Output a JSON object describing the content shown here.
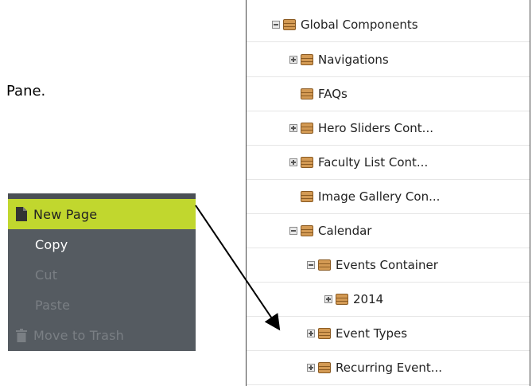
{
  "caption_fragment": "Pane.",
  "context_menu": {
    "items": [
      {
        "label": "New Page",
        "icon": "page-icon",
        "state": "active"
      },
      {
        "label": "Copy",
        "icon": "",
        "state": "enabled"
      },
      {
        "label": "Cut",
        "icon": "",
        "state": "disabled"
      },
      {
        "label": "Paste",
        "icon": "",
        "state": "disabled"
      },
      {
        "label": "Move to Trash",
        "icon": "trash-icon",
        "state": "disabled"
      }
    ]
  },
  "tree": {
    "rows": [
      {
        "label": "Global Components",
        "toggle": "minus"
      },
      {
        "label": "Navigations",
        "toggle": "plus"
      },
      {
        "label": "FAQs",
        "toggle": "none"
      },
      {
        "label": "Hero Sliders Cont...",
        "toggle": "plus"
      },
      {
        "label": "Faculty List Cont...",
        "toggle": "plus"
      },
      {
        "label": "Image Gallery Con...",
        "toggle": "none"
      },
      {
        "label": "Calendar",
        "toggle": "minus"
      },
      {
        "label": "Events Container",
        "toggle": "minus"
      },
      {
        "label": "2014",
        "toggle": "plus"
      },
      {
        "label": "Event Types",
        "toggle": "plus"
      },
      {
        "label": "Recurring Event...",
        "toggle": "plus"
      }
    ]
  },
  "colors": {
    "menu_bg": "#555b61",
    "menu_active": "#c1d72e",
    "folder_icon": "#d39a54"
  }
}
